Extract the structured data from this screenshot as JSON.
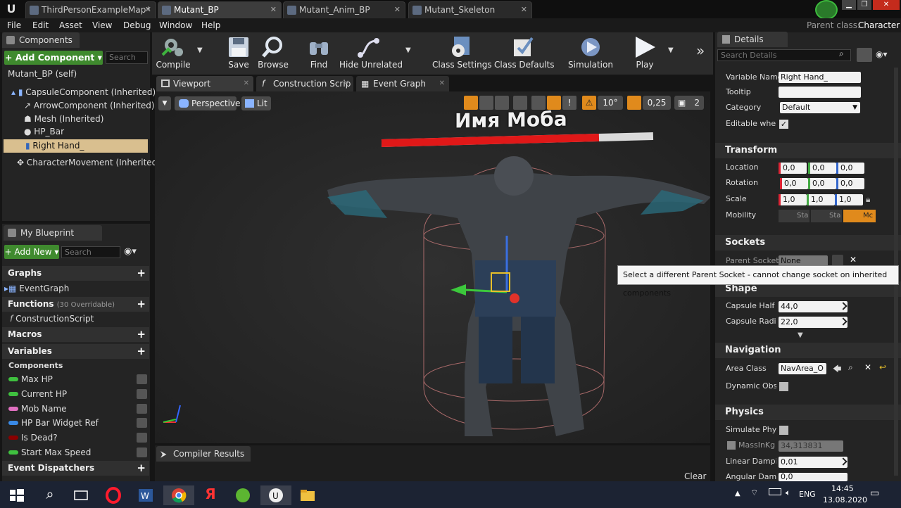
{
  "tabs": [
    {
      "label": "ThirdPersonExampleMap*"
    },
    {
      "label": "Mutant_BP"
    },
    {
      "label": "Mutant_Anim_BP"
    },
    {
      "label": "Mutant_Skeleton"
    }
  ],
  "parent_class_label": "Parent class:",
  "parent_class_value": "Character",
  "menu": [
    "File",
    "Edit",
    "Asset",
    "View",
    "Debug",
    "Window",
    "Help"
  ],
  "components": {
    "tab": "Components",
    "add_button": "+ Add Component ▾",
    "search_placeholder": "Search",
    "self_item": "Mutant_BP (self)",
    "items": [
      "CapsuleComponent (Inherited)",
      "ArrowComponent (Inherited)",
      "Mesh (Inherited)",
      "HP_Bar",
      "Right Hand_",
      "CharacterMovement (Inherited)"
    ]
  },
  "my_blueprint": {
    "tab": "My Blueprint",
    "add_new": "+ Add New ▾",
    "search_placeholder": "Search",
    "graphs": "Graphs",
    "event_graph": "EventGraph",
    "functions": "Functions",
    "functions_count": "(30 Overridable)",
    "construction_script": "ConstructionScript",
    "macros": "Macros",
    "variables": "Variables",
    "components_cat": "Components",
    "vars": [
      {
        "name": "Max HP",
        "color": "#3fc03f"
      },
      {
        "name": "Current HP",
        "color": "#3fc03f"
      },
      {
        "name": "Mob Name",
        "color": "#e070c0"
      },
      {
        "name": "HP Bar Widget Ref",
        "color": "#3a8ae6"
      },
      {
        "name": "Is Dead?",
        "color": "#8a0000"
      },
      {
        "name": "Start Max Speed",
        "color": "#3fc03f"
      }
    ],
    "event_dispatchers": "Event Dispatchers"
  },
  "toolbar": {
    "compile": "Compile",
    "save": "Save",
    "browse": "Browse",
    "find": "Find",
    "hide_unrelated": "Hide Unrelated",
    "class_settings": "Class Settings",
    "class_defaults": "Class Defaults",
    "simulation": "Simulation",
    "play": "Play"
  },
  "editor_tabs": {
    "viewport": "Viewport",
    "construction": "Construction Scrip",
    "event_graph": "Event Graph"
  },
  "viewport": {
    "perspective": "Perspective",
    "lit": "Lit",
    "angle_snap": "10°",
    "scale_snap": "0,25",
    "cam_speed": "2",
    "mob_name": "Имя Моба",
    "hp_fill": 0.8
  },
  "compiler": {
    "tab": "Compiler Results",
    "clear": "Clear"
  },
  "details": {
    "tab": "Details",
    "search_placeholder": "Search Details",
    "variable_name_label": "Variable Name",
    "variable_name": "Right Hand_",
    "tooltip_label": "Tooltip",
    "category_label": "Category",
    "category": "Default",
    "editable_label": "Editable when I",
    "transform": "Transform",
    "location": "Location",
    "rotation": "Rotation",
    "scale": "Scale",
    "loc": [
      "0,0",
      "0,0",
      "0,0"
    ],
    "rot": [
      "0,0",
      "0,0",
      "0,0"
    ],
    "scl": [
      "1,0",
      "1,0",
      "1,0"
    ],
    "mobility": "Mobility",
    "mobility_opts": [
      "Sta",
      "Sta",
      "Mc"
    ],
    "sockets": "Sockets",
    "parent_socket_label": "Parent Socket",
    "parent_socket": "None",
    "shape": "Shape",
    "half_height_label": "Capsule Half H",
    "half_height": "44,0",
    "radius_label": "Capsule Radius",
    "radius": "22,0",
    "navigation": "Navigation",
    "area_class_label": "Area Class",
    "area_class": "NavArea_O",
    "dynamic_label": "Dynamic Obsta",
    "physics": "Physics",
    "simulate_label": "Simulate Physi",
    "mass_label": "MassInKg",
    "mass": "34,313831",
    "lin_damp_label": "Linear Damping",
    "lin_damp": "0,01",
    "ang_damp_label": "Angular Dampi",
    "ang_damp": "0,0"
  },
  "tooltip": "Select a different Parent Socket - cannot change socket on inherited components",
  "taskbar": {
    "lang": "ENG",
    "time": "14:45",
    "date": "13.08.2020"
  }
}
